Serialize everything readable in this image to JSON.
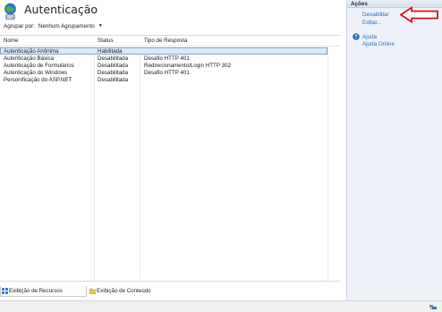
{
  "main": {
    "title": "Autenticação",
    "group_by": {
      "label": "Agrupar por:",
      "value": "Nenhum Agrupamento"
    },
    "columns": [
      "Nome",
      "Status",
      "Tipo de Resposta"
    ],
    "rows": [
      {
        "name": "Autenticação Anônima",
        "status": "Habilitada",
        "response": "",
        "selected": true
      },
      {
        "name": "Autenticação Básica",
        "status": "Desabilitada",
        "response": "Desafio HTTP 401"
      },
      {
        "name": "Autenticação de Formulários",
        "status": "Desabilitada",
        "response": "Redirecionamento/Login HTTP 302"
      },
      {
        "name": "Autenticação do Windows",
        "status": "Desabilitada",
        "response": "Desafio HTTP 401"
      },
      {
        "name": "Personificação do ASP.NET",
        "status": "Desabilitada",
        "response": ""
      }
    ],
    "view_tabs": {
      "features": "Exibição de Recursos",
      "content": "Exibição de Conteúdo"
    }
  },
  "actions": {
    "title": "Ações",
    "disable": "Desabilitar",
    "edit": "Editar...",
    "help": "Ajuda",
    "online_help": "Ajuda Online"
  },
  "colors": {
    "link": "#1f6fc5",
    "selection": "#dfeaf8",
    "annotation_arrow": "#e01010"
  },
  "icons": [
    "authentication-globe-icon",
    "help-icon",
    "features-view-icon",
    "content-view-icon",
    "network-status-icon",
    "red-arrow-annotation"
  ]
}
